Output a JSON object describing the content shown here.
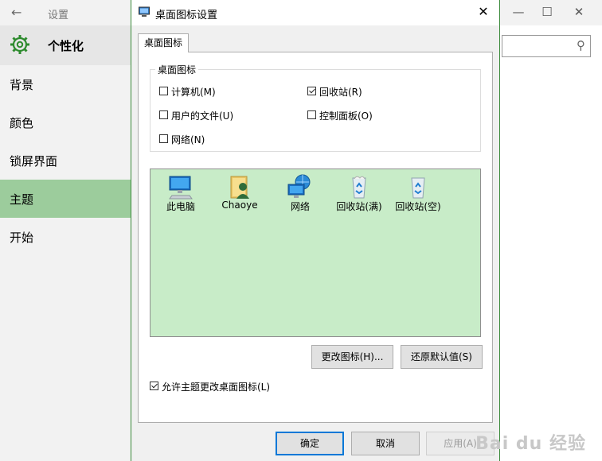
{
  "settings": {
    "title": "设置",
    "home_label": "个性化",
    "nav": [
      "背景",
      "颜色",
      "锁屏界面",
      "主题",
      "开始"
    ],
    "active_nav": 3,
    "search_placeholder": ""
  },
  "dialog": {
    "title": "桌面图标设置",
    "tab": "桌面图标",
    "group_label": "桌面图标",
    "checkboxes": [
      {
        "label": "计算机(M)",
        "checked": false
      },
      {
        "label": "回收站(R)",
        "checked": true
      },
      {
        "label": "用户的文件(U)",
        "checked": false
      },
      {
        "label": "控制面板(O)",
        "checked": false
      },
      {
        "label": "网络(N)",
        "checked": false
      }
    ],
    "icons": [
      {
        "label": "此电脑",
        "icon": "computer-icon"
      },
      {
        "label": "Chaoye",
        "icon": "user-folder-icon"
      },
      {
        "label": "网络",
        "icon": "network-icon"
      },
      {
        "label": "回收站(满)",
        "icon": "recycle-bin-full-icon"
      },
      {
        "label": "回收站(空)",
        "icon": "recycle-bin-empty-icon"
      }
    ],
    "change_icon_button": "更改图标(H)...",
    "restore_default_button": "还原默认值(S)",
    "allow_themes_checkbox": {
      "label": "允许主题更改桌面图标(L)",
      "checked": true
    },
    "ok_button": "确定",
    "cancel_button": "取消",
    "apply_button": "应用(A)"
  },
  "watermark": "Bai du 经验"
}
